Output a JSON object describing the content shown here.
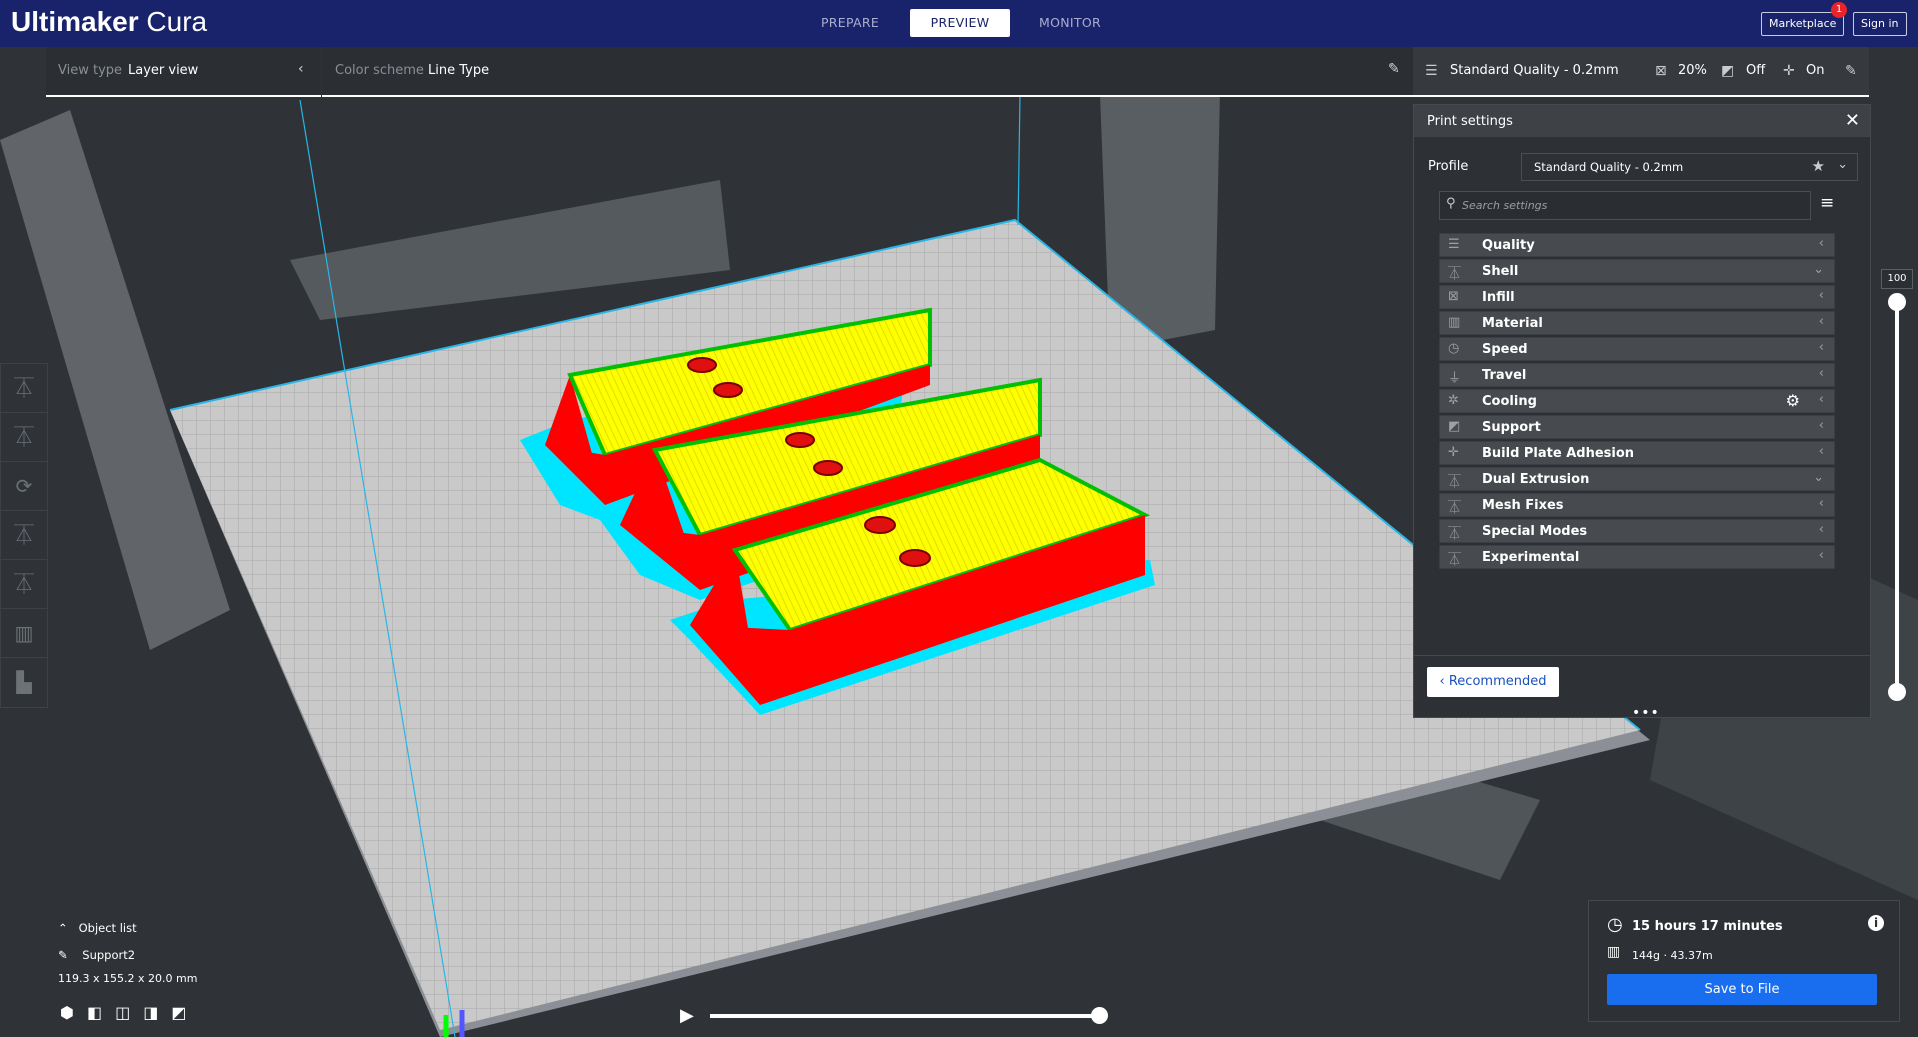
{
  "app": {
    "title_bold": "Ultimaker",
    "title_light": " Cura"
  },
  "stages": [
    {
      "label": "PREPARE",
      "active": false
    },
    {
      "label": "PREVIEW",
      "active": true
    },
    {
      "label": "MONITOR",
      "active": false
    }
  ],
  "header": {
    "marketplace_label": "Marketplace",
    "marketplace_badge": "1",
    "signin_label": "Sign in"
  },
  "viewbar": {
    "view_type_label": "View type",
    "view_type_value": "Layer view",
    "color_scheme_label": "Color scheme",
    "color_scheme_value": "Line Type"
  },
  "printbar": {
    "profile": "Standard Quality - 0.2mm",
    "infill": "20%",
    "support": "Off",
    "adhesion": "On"
  },
  "panel": {
    "title": "Print settings",
    "profile_label": "Profile",
    "profile_value": "Standard Quality - 0.2mm",
    "search_placeholder": "Search settings",
    "categories": [
      {
        "label": "Quality",
        "icon": "quality-icon",
        "chevron": "‹"
      },
      {
        "label": "Shell",
        "icon": "shell-icon",
        "chevron": "⌄"
      },
      {
        "label": "Infill",
        "icon": "infill-icon",
        "chevron": "‹"
      },
      {
        "label": "Material",
        "icon": "material-icon",
        "chevron": "‹"
      },
      {
        "label": "Speed",
        "icon": "speed-icon",
        "chevron": "‹"
      },
      {
        "label": "Travel",
        "icon": "travel-icon",
        "chevron": "‹"
      },
      {
        "label": "Cooling",
        "icon": "cooling-icon",
        "chevron": "‹"
      },
      {
        "label": "Support",
        "icon": "support-icon",
        "chevron": "‹"
      },
      {
        "label": "Build Plate Adhesion",
        "icon": "adhesion-icon",
        "chevron": "‹"
      },
      {
        "label": "Dual Extrusion",
        "icon": "dual-extrusion-icon",
        "chevron": "⌄"
      },
      {
        "label": "Mesh Fixes",
        "icon": "mesh-fixes-icon",
        "chevron": "‹"
      },
      {
        "label": "Special Modes",
        "icon": "special-modes-icon",
        "chevron": "‹"
      },
      {
        "label": "Experimental",
        "icon": "experimental-icon",
        "chevron": "‹"
      }
    ],
    "recommended_label": "Recommended"
  },
  "object": {
    "list_label": "Object list",
    "name": "Support2",
    "dimensions": "119.3 x 155.2 x 20.0 mm"
  },
  "layer_slider": {
    "value": "100",
    "max": 100
  },
  "playback": {
    "position": 1.0
  },
  "estimate": {
    "time": "15 hours 17 minutes",
    "material": "144g · 43.37m",
    "save_label": "Save to File"
  },
  "colors": {
    "header": "#19236b",
    "accent": "#196ef0",
    "shell": "#ff0000",
    "top_skin": "#ffff00",
    "inner_wall": "#00ff00",
    "support": "#00e5ff"
  }
}
